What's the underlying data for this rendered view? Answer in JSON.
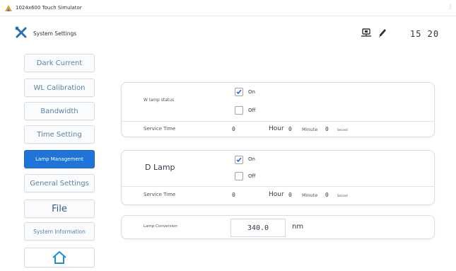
{
  "window": {
    "title": "1024x600 Touch Simulator"
  },
  "header": {
    "title": "System Settings",
    "time": "15 20"
  },
  "sidebar": [
    {
      "label": "Dark Current"
    },
    {
      "label": "WL Calibration"
    },
    {
      "label": "Bandwidth"
    },
    {
      "label": "Time Setting"
    },
    {
      "label": "Lamp Management"
    },
    {
      "label": "General Settings"
    },
    {
      "label": "File"
    },
    {
      "label": "System Information"
    }
  ],
  "w_lamp": {
    "label": "W lamp status",
    "on_label": "On",
    "off_label": "Off",
    "on_checked": true,
    "off_checked": false,
    "service_time_label": "Service Time",
    "hours_value": "0",
    "hour_label": "Hour",
    "minutes_value": "0",
    "minute_label": "Minute",
    "seconds_value": "0",
    "second_label": "Second"
  },
  "d_lamp": {
    "label": "D Lamp",
    "on_label": "On",
    "off_label": "Off",
    "on_checked": true,
    "off_checked": false,
    "service_time_label": "Service Time",
    "hours_value": "0",
    "hour_label": "Hour",
    "minutes_value": "0",
    "minute_label": "Minute",
    "seconds_value": "0",
    "second_label": "Second"
  },
  "lamp_conversion": {
    "label": "Lamp Conversion",
    "value": "340.0",
    "unit": "nm"
  },
  "colors": {
    "accent": "#1f74d8",
    "button_text": "#5a82a8",
    "card_border": "#d9dee4"
  },
  "icons": [
    "app-icon",
    "tools-icon",
    "network-icon",
    "pen-icon",
    "home-icon",
    "check-icon"
  ]
}
